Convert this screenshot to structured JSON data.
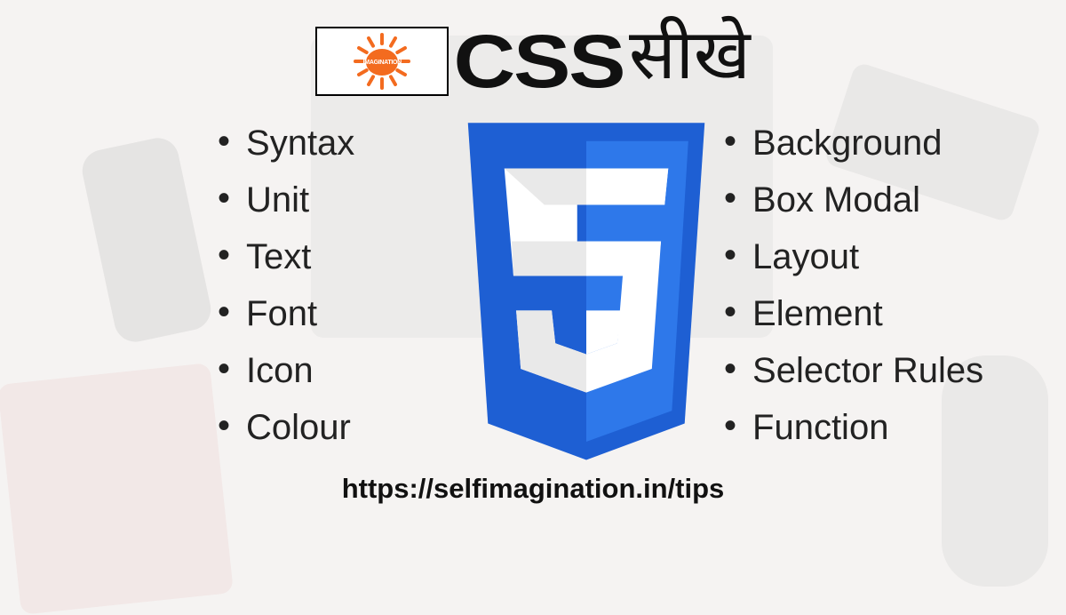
{
  "logo": {
    "label": "IMAGINATION"
  },
  "title": {
    "css": "CSS",
    "hindi": "सीखे"
  },
  "left_list": [
    "Syntax",
    "Unit",
    "Text",
    "Font",
    "Icon",
    "Colour"
  ],
  "right_list": [
    "Background",
    "Box Modal",
    "Layout",
    "Element",
    "Selector Rules",
    "Function"
  ],
  "url": "https://selfimagination.in/tips"
}
